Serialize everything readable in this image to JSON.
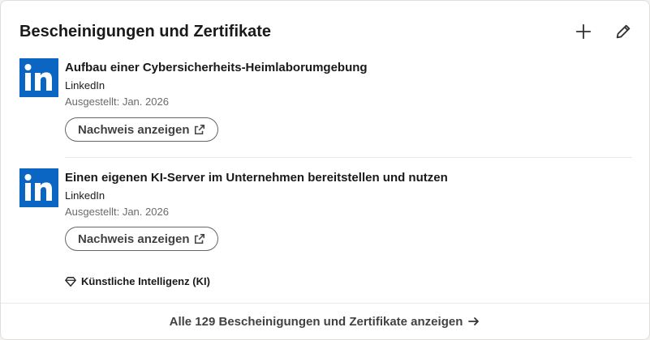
{
  "section": {
    "title": "Bescheinigungen und Zertifikate"
  },
  "icons": {
    "add": "plus-icon",
    "edit": "pencil-icon",
    "logo": "linkedin-logo-icon",
    "external": "external-link-icon",
    "skill": "diamond-icon",
    "arrow": "arrow-right-icon"
  },
  "colors": {
    "linkedin_blue": "#0a66c2"
  },
  "certificates": [
    {
      "title": "Aufbau einer Cybersicherheits-Heimlaborumgebung",
      "issuer": "LinkedIn",
      "issued": "Ausgestellt: Jan. 2026",
      "button_label": "Nachweis anzeigen"
    },
    {
      "title": "Einen eigenen KI-Server im Unternehmen bereitstellen und nutzen",
      "issuer": "LinkedIn",
      "issued": "Ausgestellt: Jan. 2026",
      "button_label": "Nachweis anzeigen",
      "skill": "Künstliche Intelligenz (KI)"
    }
  ],
  "footer": {
    "label": "Alle 129 Bescheinigungen und Zertifikate anzeigen"
  }
}
